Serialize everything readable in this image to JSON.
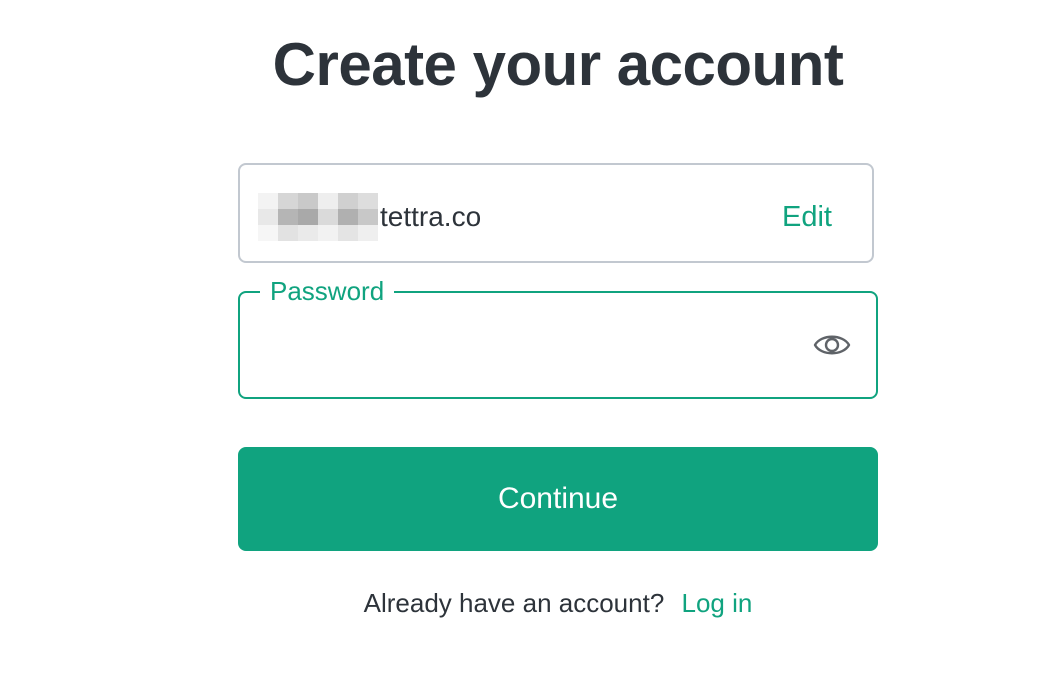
{
  "heading": "Create your account",
  "email": {
    "visible_suffix": "tettra.co",
    "edit_label": "Edit"
  },
  "password": {
    "label": "Password",
    "value": "",
    "toggle_icon": "eye-icon"
  },
  "continue_label": "Continue",
  "footer": {
    "prompt": "Already have an account?",
    "login_label": "Log in"
  },
  "colors": {
    "brand": "#10a37f",
    "text": "#2d333a",
    "border": "#c2c8d0"
  }
}
